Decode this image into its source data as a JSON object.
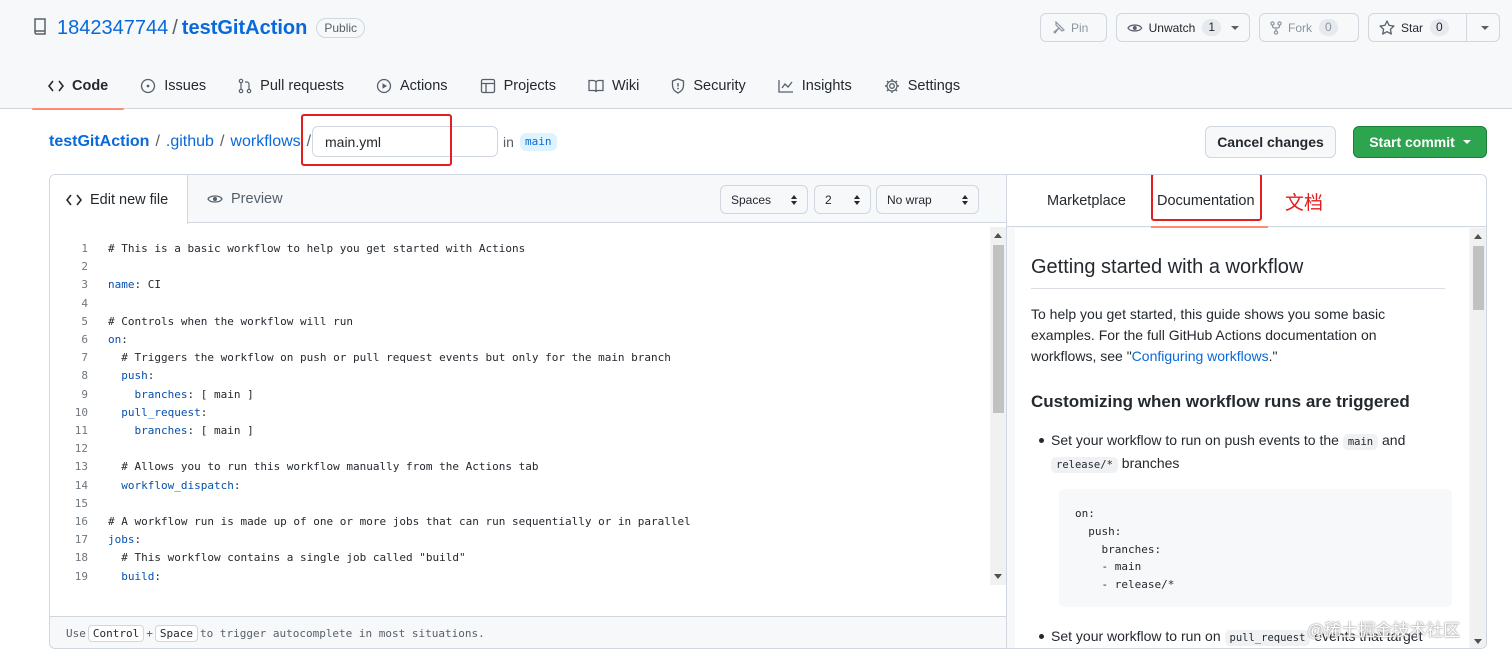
{
  "repo": {
    "owner": "1842347744",
    "separator": "/",
    "name": "testGitAction",
    "visibility": "Public"
  },
  "actions_bar": {
    "pin": "Pin",
    "watch": "Unwatch",
    "watch_count": "1",
    "fork": "Fork",
    "fork_count": "0",
    "star": "Star",
    "star_count": "0"
  },
  "tabs": [
    {
      "label": "Code",
      "icon": "code-icon",
      "active": true
    },
    {
      "label": "Issues",
      "icon": "issue-icon"
    },
    {
      "label": "Pull requests",
      "icon": "pull-request-icon"
    },
    {
      "label": "Actions",
      "icon": "play-icon"
    },
    {
      "label": "Projects",
      "icon": "table-icon"
    },
    {
      "label": "Wiki",
      "icon": "book-icon"
    },
    {
      "label": "Security",
      "icon": "shield-icon"
    },
    {
      "label": "Insights",
      "icon": "graph-icon"
    },
    {
      "label": "Settings",
      "icon": "gear-icon"
    }
  ],
  "breadcrumb": {
    "root": "testGitAction",
    "dir1": ".github",
    "dir2": "workflows",
    "sep": "/",
    "filename": "main.yml",
    "in_label": "in",
    "branch": "main"
  },
  "buttons": {
    "cancel": "Cancel changes",
    "commit": "Start commit"
  },
  "editor": {
    "tab_edit": "Edit new file",
    "tab_preview": "Preview",
    "indent_mode": "Spaces",
    "indent_size": "2",
    "wrap_mode": "No wrap",
    "lines": [
      {
        "n": "1",
        "text": "# This is a basic workflow to help you get started with Actions"
      },
      {
        "n": "2",
        "text": ""
      },
      {
        "n": "3",
        "key": "name",
        "rest": ": CI"
      },
      {
        "n": "4",
        "text": ""
      },
      {
        "n": "5",
        "text": "# Controls when the workflow will run"
      },
      {
        "n": "6",
        "key": "on",
        "rest": ":"
      },
      {
        "n": "7",
        "text": "  # Triggers the workflow on push or pull request events but only for the main branch"
      },
      {
        "n": "8",
        "indent": "  ",
        "key": "push",
        "rest": ":"
      },
      {
        "n": "9",
        "indent": "    ",
        "key": "branches",
        "rest": ": [ main ]"
      },
      {
        "n": "10",
        "indent": "  ",
        "key": "pull_request",
        "rest": ":"
      },
      {
        "n": "11",
        "indent": "    ",
        "key": "branches",
        "rest": ": [ main ]"
      },
      {
        "n": "12",
        "text": ""
      },
      {
        "n": "13",
        "text": "  # Allows you to run this workflow manually from the Actions tab"
      },
      {
        "n": "14",
        "indent": "  ",
        "key": "workflow_dispatch",
        "rest": ":"
      },
      {
        "n": "15",
        "text": ""
      },
      {
        "n": "16",
        "text": "# A workflow run is made up of one or more jobs that can run sequentially or in parallel"
      },
      {
        "n": "17",
        "key": "jobs",
        "rest": ":"
      },
      {
        "n": "18",
        "text": "  # This workflow contains a single job called \"build\""
      },
      {
        "n": "19",
        "indent": "  ",
        "key": "build",
        "rest": ":"
      }
    ],
    "footer_use": "Use",
    "footer_key1": "Control",
    "footer_plus": "+",
    "footer_key2": "Space",
    "footer_rest": "to trigger autocomplete in most situations."
  },
  "docs": {
    "tab_marketplace": "Marketplace",
    "tab_documentation": "Documentation",
    "annotation": "文档",
    "heading": "Getting started with a workflow",
    "intro_text": "To help you get started, this guide shows you some basic examples. For the full GitHub Actions documentation on workflows, see \"",
    "intro_link": "Configuring workflows",
    "intro_end": ".\"",
    "subheading": "Customizing when workflow runs are triggered",
    "bullet1_a": "Set your workflow to run on push events to the",
    "bullet1_code1": "main",
    "bullet1_b": "and",
    "bullet1_code2": "release/*",
    "bullet1_c": "branches",
    "code_block": "on:\n  push:\n    branches:\n    - main\n    - release/*",
    "bullet2_a": "Set your workflow to run on",
    "bullet2_code": "pull_request",
    "bullet2_b": "events that target"
  },
  "watermark": "@稀土掘金技术社区",
  "colors": {
    "link": "#0969da",
    "accent_underline": "#fd8c73",
    "commit_green": "#2da44e",
    "annotation_red": "#e02020"
  }
}
